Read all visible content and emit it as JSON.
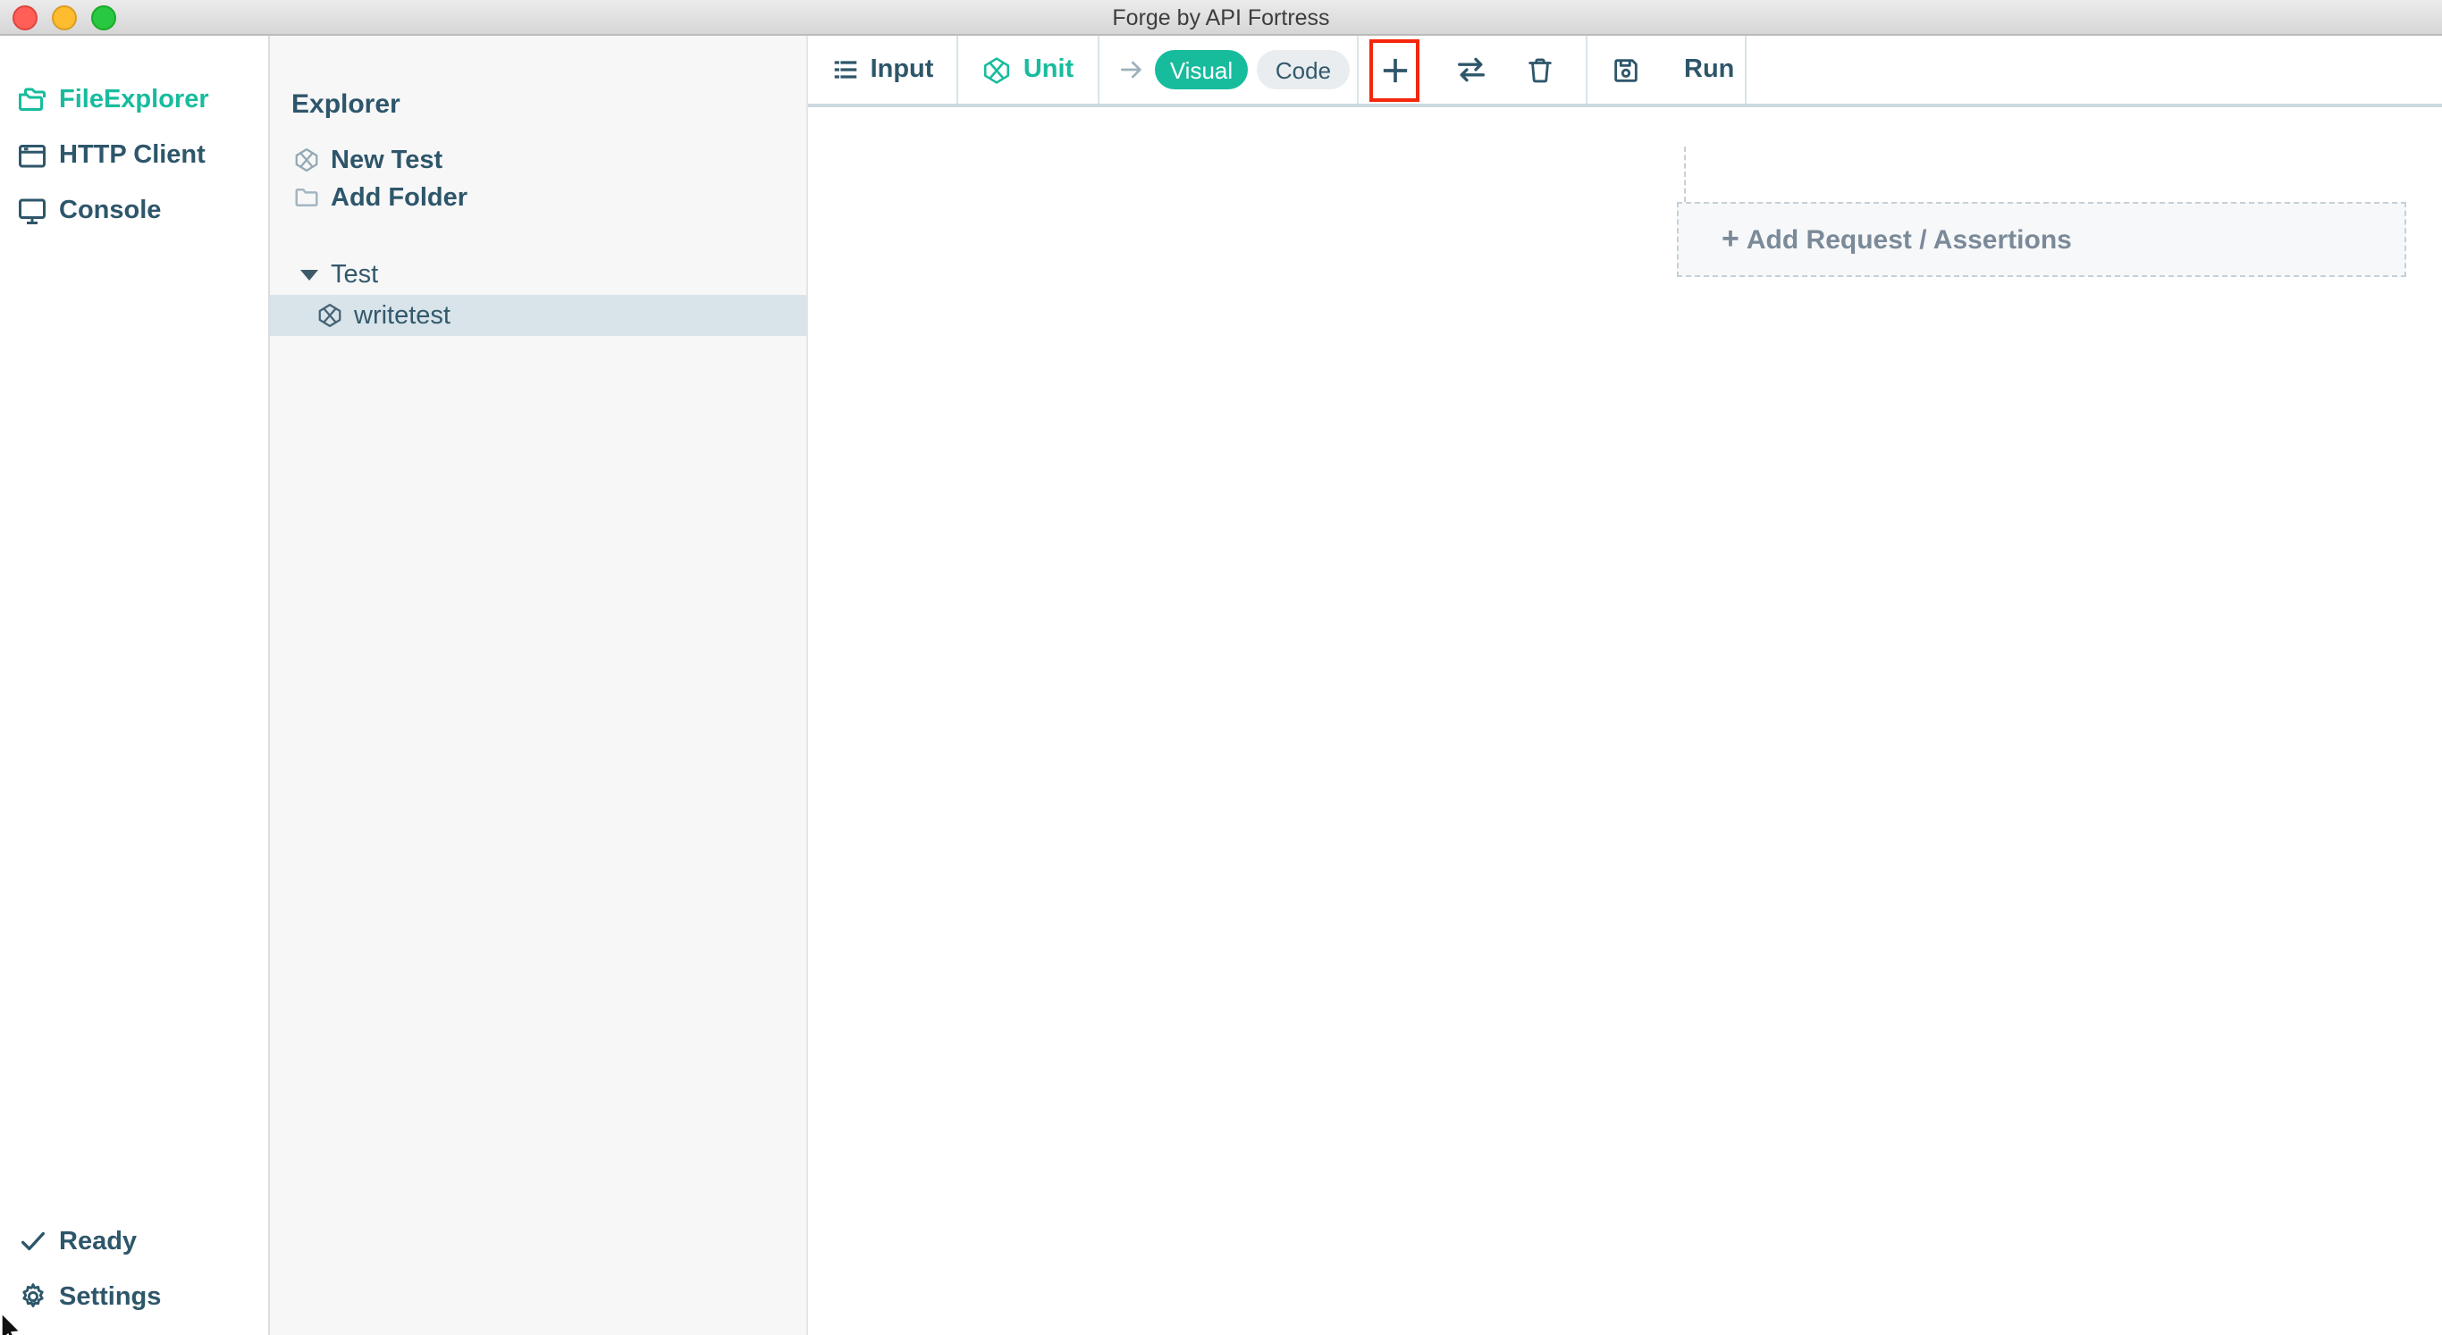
{
  "window": {
    "title": "Forge by API Fortress"
  },
  "sidebar": {
    "items": [
      {
        "label": "FileExplorer",
        "icon": "folders-icon",
        "active": true
      },
      {
        "label": "HTTP Client",
        "icon": "browser-window-icon",
        "active": false
      },
      {
        "label": "Console",
        "icon": "monitor-icon",
        "active": false
      }
    ],
    "status": {
      "label": "Ready",
      "icon": "check-icon"
    },
    "settings": {
      "label": "Settings",
      "icon": "gear-icon"
    }
  },
  "explorer": {
    "title": "Explorer",
    "actions": [
      {
        "label": "New Test",
        "icon": "cube-icon"
      },
      {
        "label": "Add Folder",
        "icon": "folder-icon"
      }
    ],
    "tree": {
      "folder": {
        "label": "Test",
        "expanded": true
      },
      "children": [
        {
          "label": "writetest",
          "icon": "cube-icon",
          "selected": true
        }
      ]
    }
  },
  "toolbar": {
    "input": {
      "label": "Input"
    },
    "unit": {
      "label": "Unit"
    },
    "view_toggle": {
      "options": [
        "Visual",
        "Code"
      ],
      "selected": "Visual"
    },
    "run": {
      "label": "Run"
    },
    "highlight_color": "#f4260c"
  },
  "canvas": {
    "plus_glyph": "+",
    "add_request_label": "Add Request / Assertions"
  },
  "colors": {
    "accent_teal": "#17bc9d",
    "text_dark": "#2e566a",
    "selected_row_bg": "#d8e4ea",
    "highlight_red": "#f4260c",
    "pill_code_bg": "#e9edf0",
    "dashed_border": "#c5d0d8"
  }
}
